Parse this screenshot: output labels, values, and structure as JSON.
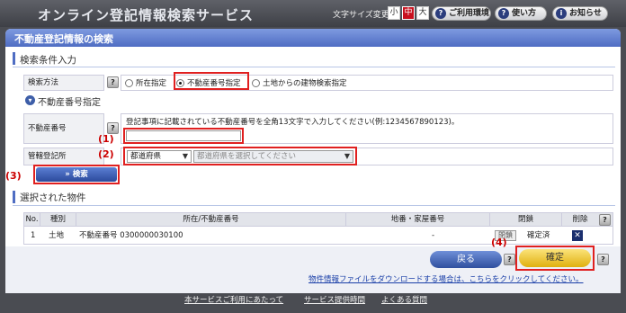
{
  "header": {
    "title": "オンライン登記情報検索サービス",
    "font_size_label": "文字サイズ変更",
    "font_sizes": [
      "小",
      "中",
      "大"
    ],
    "env_button": "ご利用環境",
    "howto_button": "使い方",
    "news_button": "お知らせ"
  },
  "page": {
    "bar_title": "不動産登記情報の検索"
  },
  "search_conditions": {
    "heading": "検索条件入力",
    "method_label": "検索方法",
    "help": "?",
    "methods": [
      "所在指定",
      "不動産番号指定",
      "土地からの建物検索指定"
    ],
    "selected_method": "不動産番号指定",
    "sub_heading": "不動産番号指定",
    "number_label": "不動産番号",
    "number_hint": "登記事項に記載されている不動産番号を全角13文字で入力してください(例:1234567890123)。",
    "number_value": "",
    "jurisdiction_label": "管轄登記所",
    "prefecture_select": "都道府県",
    "office_select": "都道府県を選択してください",
    "search_button": "» 検索"
  },
  "annotations": {
    "n1": "(1)",
    "n2": "(2)",
    "n3": "(3)",
    "n4": "(4)"
  },
  "selected": {
    "heading": "選択された物件",
    "columns": [
      "No.",
      "種別",
      "所在/不動産番号",
      "地番・家屋番号",
      "閉鎖",
      "削除"
    ],
    "rows": [
      {
        "no": "1",
        "type": "土地",
        "location": "不動産番号 0300000030100",
        "lot": "-",
        "closed_btn": "閉鎖",
        "closed_status": "確定済",
        "delete": "✕"
      }
    ]
  },
  "actions": {
    "back": "戻る",
    "confirm": "確定",
    "download_link": "物件情報ファイルをダウンロードする場合は、こちらをクリックしてください。"
  },
  "footer": {
    "links": [
      "本サービスご利用にあたって",
      "サービス提供時間",
      "よくある質問"
    ]
  },
  "colors": {
    "header_bg": "#4a4c52",
    "title_bar": "#5a78cc",
    "highlight": "#e02020",
    "confirm_button": "#f0c020",
    "back_button": "#3d5ea8"
  }
}
